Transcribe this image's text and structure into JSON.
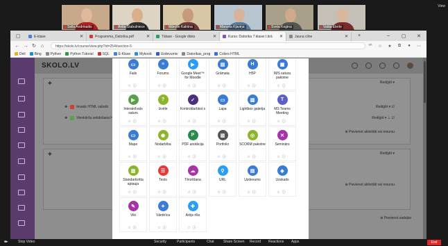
{
  "zoom": {
    "participants": [
      "Sella Andrinaitis",
      "Anita Stabulniece",
      "Mārcīte Kalnina",
      "Marsela Kļaviņa",
      "Sveta Kogina",
      "Valda Elerte"
    ],
    "view_label": "View",
    "bottom": {
      "mute": "",
      "video": "Stop Video",
      "security": "Security",
      "participants": "Participants",
      "chat": "Chat",
      "share": "Share Screen",
      "record": "Record",
      "reactions": "Reactions",
      "apps": "Apps",
      "end": "End"
    }
  },
  "browser": {
    "tabs": [
      {
        "label": "E-klase",
        "color": "#4a7fd1"
      },
      {
        "label": "Programma_Datorika.pdf",
        "color": "#d23f31"
      },
      {
        "label": "Tālase - Google disks",
        "color": "#1fa463"
      },
      {
        "label": "Kurss: Datorika 7.klasei I.tirā",
        "color": "#8a4fb0",
        "active": true
      },
      {
        "label": "Jauna cilne",
        "color": "#888888"
      }
    ],
    "url": "https://skolo.lv/course/view.php?id=254#section-5",
    "favorites": [
      {
        "label": "Deli",
        "color": "#e6b422"
      },
      {
        "label": "Bing",
        "color": "#1a8ccc"
      },
      {
        "label": "Python",
        "color": "#888888"
      },
      {
        "label": "Python Tutorial",
        "color": "#2b9c3f"
      },
      {
        "label": "SQL",
        "color": "#c33"
      },
      {
        "label": "E-Klase",
        "color": "#4a7fd1"
      },
      {
        "label": "Mykoob",
        "color": "#2a8fd6"
      },
      {
        "label": "Uzdevumiv",
        "color": "#3559c7"
      },
      {
        "label": "Datorikas_prog",
        "color": "#888888"
      },
      {
        "label": "Colors HTML",
        "color": "#3a6fd8"
      }
    ]
  },
  "site": {
    "logo": "SKOLO.LV",
    "edit": "Rediģēt",
    "activities": [
      {
        "label": "Ievads HTML valodā",
        "color": "#d23f31"
      },
      {
        "label": "Vienkāršu sekdošana HTML",
        "color": "#5aa04a"
      }
    ],
    "add_activity": "Pievienot aktivitāti vai resursu",
    "add_section": "Pievienot sadaļas"
  },
  "modal": {
    "items": [
      {
        "label": "Fails",
        "color": "#3a7bd5",
        "glyph": "▭"
      },
      {
        "label": "Forums",
        "color": "#3a7bd5",
        "glyph": "≡"
      },
      {
        "label": "Google Meet™ for Moodle",
        "color": "#2a9df4",
        "glyph": "▶"
      },
      {
        "label": "Grāmata",
        "color": "#3a7bd5",
        "glyph": "▤"
      },
      {
        "label": "H5P",
        "color": "#3a7bd5",
        "glyph": "H"
      },
      {
        "label": "IMS satura pakotne",
        "color": "#3a7bd5",
        "glyph": "▦"
      },
      {
        "label": "InteraktīvaIs saturs",
        "color": "#5aa04a",
        "glyph": "▶"
      },
      {
        "label": "Izvēle",
        "color": "#8bb52a",
        "glyph": "?"
      },
      {
        "label": "Kontroldarbkst s",
        "color": "#4a2f7f",
        "glyph": "✓"
      },
      {
        "label": "Lapa",
        "color": "#3a7bd5",
        "glyph": "▭"
      },
      {
        "label": "Lightbox galerija",
        "color": "#3a7bd5",
        "glyph": "▧"
      },
      {
        "label": "MS Teams Meeting",
        "color": "#5b5fc7",
        "glyph": "T"
      },
      {
        "label": "Mape",
        "color": "#3a7bd5",
        "glyph": "▭"
      },
      {
        "label": "Nodarbība",
        "color": "#8bb52a",
        "glyph": "◉"
      },
      {
        "label": "PDF anotācija",
        "color": "#2a8a4a",
        "glyph": "P"
      },
      {
        "label": "Portfolio",
        "color": "#555555",
        "glyph": "▥"
      },
      {
        "label": "SCORM pakotne",
        "color": "#8bb52a",
        "glyph": "◎"
      },
      {
        "label": "Seminārs",
        "color": "#a833a8",
        "glyph": "✕"
      },
      {
        "label": "Standartizēta aptauja",
        "color": "#8bb52a",
        "glyph": "▥"
      },
      {
        "label": "Tests",
        "color": "#e23b3b",
        "glyph": "☰"
      },
      {
        "label": "Tērzēšana",
        "color": "#a833a8",
        "glyph": "☁"
      },
      {
        "label": "URL",
        "color": "#2a9df4",
        "glyph": "⚲"
      },
      {
        "label": "Uzdevums",
        "color": "#3a7bd5",
        "glyph": "▤"
      },
      {
        "label": "Uzskaits",
        "color": "#3a7bd5",
        "glyph": "◈"
      },
      {
        "label": "Viki",
        "color": "#a833a8",
        "glyph": "✎"
      },
      {
        "label": "Vārdnīca",
        "color": "#3a7bd5",
        "glyph": "✦"
      },
      {
        "label": "Ārējs rīks",
        "color": "#2a9df4",
        "glyph": "✚"
      }
    ]
  }
}
